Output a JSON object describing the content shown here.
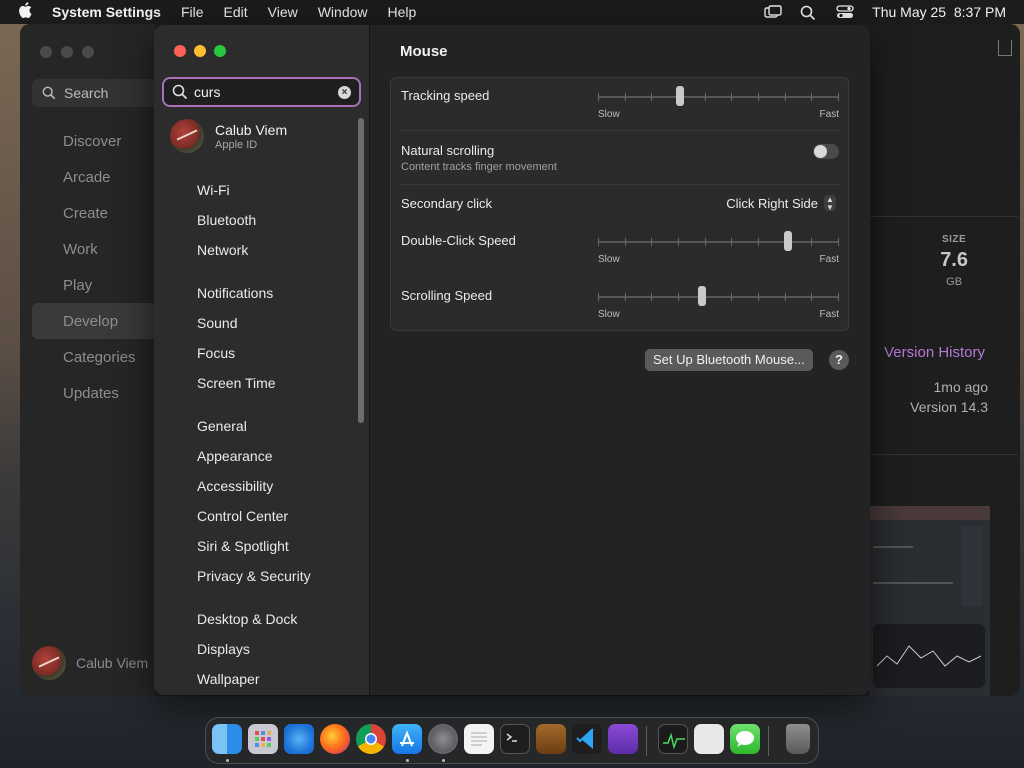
{
  "menubar": {
    "app_name": "System Settings",
    "items": [
      "File",
      "Edit",
      "View",
      "Window",
      "Help"
    ],
    "datetime": "Thu May 25  8:37 PM"
  },
  "background_app": {
    "search_label": "Search",
    "nav": [
      "Discover",
      "Arcade",
      "Create",
      "Work",
      "Play",
      "Develop",
      "Categories",
      "Updates"
    ],
    "active_nav": "Develop",
    "user_name": "Calub Viem",
    "size_label": "SIZE",
    "size_value": "7.6",
    "size_unit": "GB",
    "version_history_label": "Version History",
    "updated_ago": "1mo ago",
    "version": "Version 14.3",
    "colors": {
      "version_history": "#b67ad6"
    }
  },
  "settings": {
    "search": {
      "value": "curs"
    },
    "account": {
      "name": "Calub Viem",
      "sub": "Apple ID"
    },
    "sidebar_groups": [
      [
        "Wi-Fi",
        "Bluetooth",
        "Network"
      ],
      [
        "Notifications",
        "Sound",
        "Focus",
        "Screen Time"
      ],
      [
        "General",
        "Appearance",
        "Accessibility",
        "Control Center",
        "Siri & Spotlight",
        "Privacy & Security"
      ],
      [
        "Desktop & Dock",
        "Displays",
        "Wallpaper"
      ]
    ],
    "pane_title": "Mouse",
    "tracking_speed": {
      "label": "Tracking speed",
      "min_label": "Slow",
      "max_label": "Fast",
      "value": 0.34
    },
    "natural_scrolling": {
      "label": "Natural scrolling",
      "sub": "Content tracks finger movement",
      "enabled": false
    },
    "secondary_click": {
      "label": "Secondary click",
      "value": "Click Right Side"
    },
    "double_click_speed": {
      "label": "Double-Click Speed",
      "min_label": "Slow",
      "max_label": "Fast",
      "value": 0.79
    },
    "scrolling_speed": {
      "label": "Scrolling Speed",
      "min_label": "Slow",
      "max_label": "Fast",
      "value": 0.43
    },
    "setup_button": "Set Up Bluetooth Mouse...",
    "help_button": "?",
    "colors": {
      "search_focus": "#a86fb8"
    }
  },
  "dock": {
    "apps": [
      "Finder",
      "Launchpad",
      "Safari",
      "Firefox",
      "Chrome",
      "App Store",
      "System Settings",
      "TextEdit",
      "Terminal",
      "GarageBand",
      "Visual Studio Code",
      "Visual Studio",
      "Activity Monitor",
      "Script Editor",
      "Messages",
      "Trash"
    ]
  }
}
